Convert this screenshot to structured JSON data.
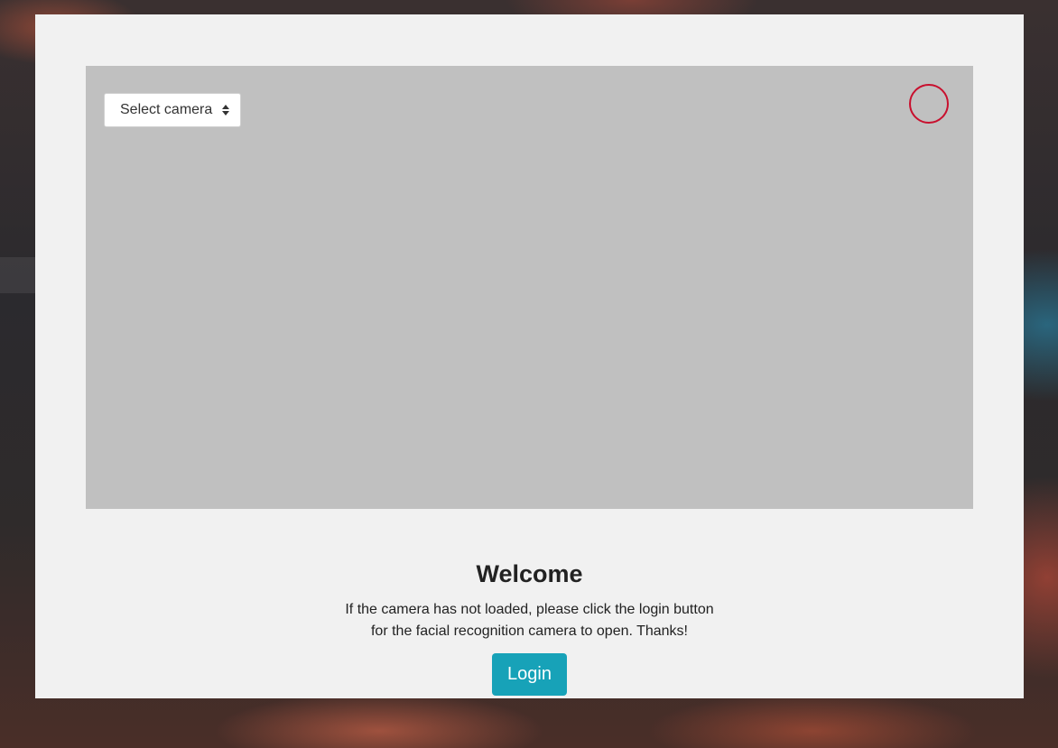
{
  "camera": {
    "select_label": "Select camera",
    "record_indicator_color": "#c8102e",
    "area_color": "#c0c0c0"
  },
  "welcome": {
    "title": "Welcome",
    "message": "If the camera has not loaded, please click the login button for the facial recognition camera to open. Thanks!"
  },
  "login": {
    "label": "Login",
    "color": "#17a2b8"
  }
}
